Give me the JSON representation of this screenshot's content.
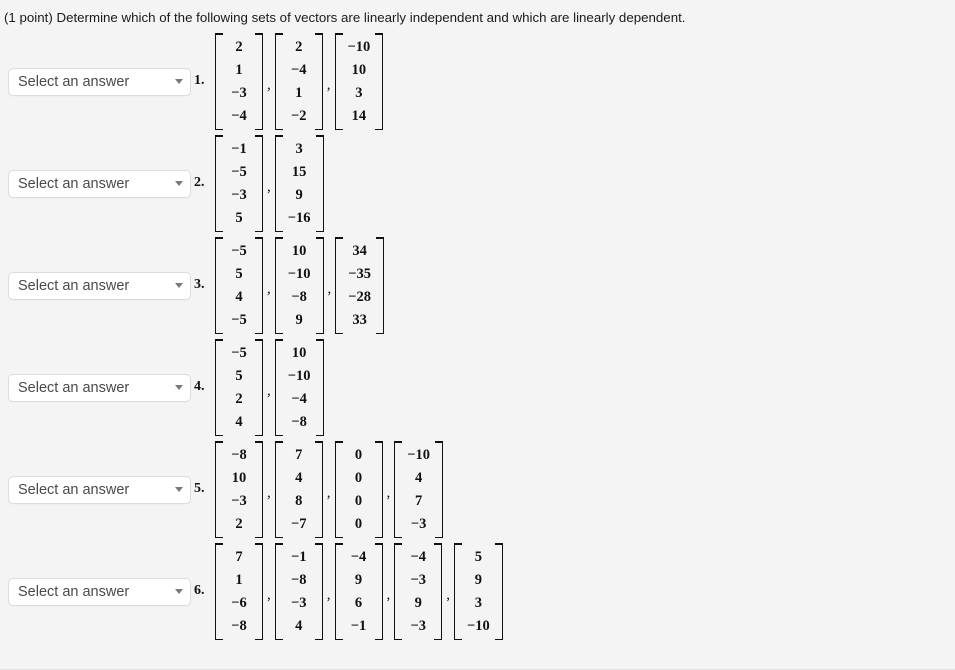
{
  "prompt": "(1 point) Determine which of the following sets of vectors are linearly independent and which are linearly dependent.",
  "select": {
    "placeholder": "Select an answer",
    "value": "Select an answer",
    "caret_icon": "chevron-down-icon",
    "options": [
      "Select an answer",
      "linearly independent",
      "linearly dependent"
    ]
  },
  "colors": {
    "page_background": "#f4f4f4",
    "select_background": "#ffffff",
    "select_border": "#dcdcdc",
    "select_text": "#4a4a4a",
    "math_text": "#111111",
    "prompt_text": "#1a1a1a"
  },
  "problems": [
    {
      "number": "1.",
      "vectors": [
        [
          "2",
          "1",
          "−3",
          "−4"
        ],
        [
          "2",
          "−4",
          "1",
          "−2"
        ],
        [
          "−10",
          "10",
          "3",
          "14"
        ]
      ]
    },
    {
      "number": "2.",
      "vectors": [
        [
          "−1",
          "−5",
          "−3",
          "5"
        ],
        [
          "3",
          "15",
          "9",
          "−16"
        ]
      ]
    },
    {
      "number": "3.",
      "vectors": [
        [
          "−5",
          "5",
          "4",
          "−5"
        ],
        [
          "10",
          "−10",
          "−8",
          "9"
        ],
        [
          "34",
          "−35",
          "−28",
          "33"
        ]
      ]
    },
    {
      "number": "4.",
      "vectors": [
        [
          "−5",
          "5",
          "2",
          "4"
        ],
        [
          "10",
          "−10",
          "−4",
          "−8"
        ]
      ]
    },
    {
      "number": "5.",
      "vectors": [
        [
          "−8",
          "10",
          "−3",
          "2"
        ],
        [
          "7",
          "4",
          "8",
          "−7"
        ],
        [
          "0",
          "0",
          "0",
          "0"
        ],
        [
          "−10",
          "4",
          "7",
          "−3"
        ]
      ]
    },
    {
      "number": "6.",
      "vectors": [
        [
          "7",
          "1",
          "−6",
          "−8"
        ],
        [
          "−1",
          "−8",
          "−3",
          "4"
        ],
        [
          "−4",
          "9",
          "6",
          "−1"
        ],
        [
          "−4",
          "−3",
          "9",
          "−3"
        ],
        [
          "5",
          "9",
          "3",
          "−10"
        ]
      ]
    }
  ],
  "separator": ","
}
